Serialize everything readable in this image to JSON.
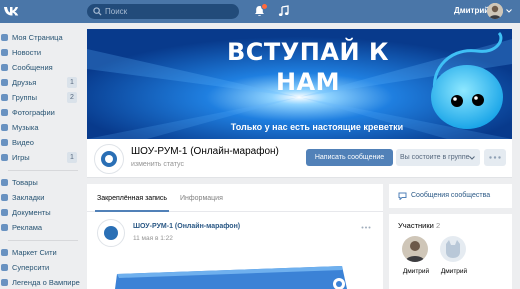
{
  "topbar": {
    "search_placeholder": "Поиск",
    "user_name": "Дмитрий",
    "accent_color": "#4a76a8"
  },
  "sidebar": {
    "items": [
      {
        "label": "Моя Страница",
        "count": ""
      },
      {
        "label": "Новости",
        "count": ""
      },
      {
        "label": "Сообщения",
        "count": ""
      },
      {
        "label": "Друзья",
        "count": "1"
      },
      {
        "label": "Группы",
        "count": "2"
      },
      {
        "label": "Фотографии",
        "count": ""
      },
      {
        "label": "Музыка",
        "count": ""
      },
      {
        "label": "Видео",
        "count": ""
      },
      {
        "label": "Игры",
        "count": "1"
      },
      {
        "label": "Товары",
        "count": ""
      },
      {
        "label": "Закладки",
        "count": ""
      },
      {
        "label": "Документы",
        "count": ""
      },
      {
        "label": "Реклама",
        "count": ""
      },
      {
        "label": "Маркет Сити",
        "count": ""
      },
      {
        "label": "Суперсити",
        "count": ""
      },
      {
        "label": "Легенда о Вампире",
        "count": ""
      }
    ]
  },
  "cover": {
    "title": "ВСТУПАЙ К НАМ",
    "subtitle": "Только у нас есть настоящие креветки"
  },
  "group": {
    "name": "ШОУ-РУМ-1 (Онлайн-марафон)",
    "status": "изменить статус",
    "message_button": "Написать сообщение",
    "membership_button": "Вы состоите в группе"
  },
  "feed": {
    "tabs": [
      "Закреплённая запись",
      "Информация"
    ],
    "post": {
      "author": "ШОУ-РУМ-1 (Онлайн-марафон)",
      "date": "11 мая в 1:22"
    }
  },
  "right": {
    "messages_link": "Сообщения сообщества",
    "members_title": "Участники",
    "members_count": "2",
    "members": [
      {
        "name": "Дмитрий"
      },
      {
        "name": "Дмитрий"
      }
    ]
  }
}
